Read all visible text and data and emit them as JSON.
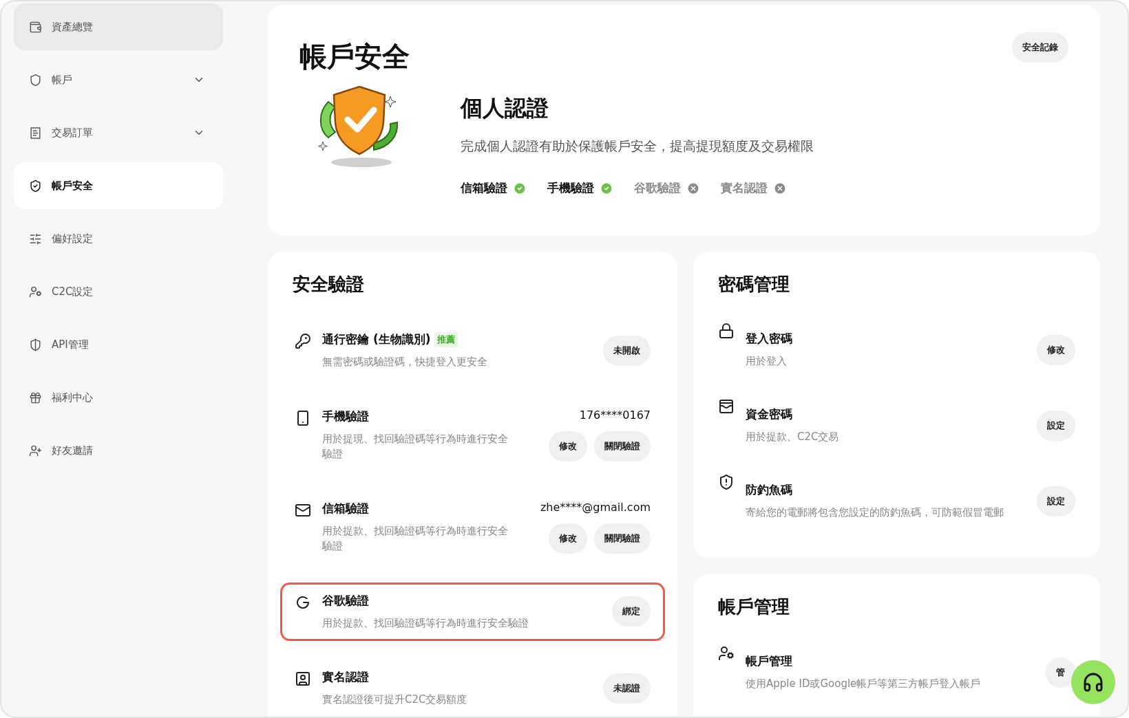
{
  "sidebar": {
    "items": [
      {
        "label": "資產總覽",
        "selected": false,
        "hovered": true,
        "expandable": false
      },
      {
        "label": "帳戶",
        "selected": false,
        "hovered": false,
        "expandable": true
      },
      {
        "label": "交易訂單",
        "selected": false,
        "hovered": false,
        "expandable": true
      },
      {
        "label": "帳戶安全",
        "selected": true,
        "hovered": false,
        "expandable": false
      },
      {
        "label": "偏好設定",
        "selected": false,
        "hovered": false,
        "expandable": false
      },
      {
        "label": "C2C設定",
        "selected": false,
        "hovered": false,
        "expandable": false
      },
      {
        "label": "API管理",
        "selected": false,
        "hovered": false,
        "expandable": false
      },
      {
        "label": "福利中心",
        "selected": false,
        "hovered": false,
        "expandable": false
      },
      {
        "label": "好友邀請",
        "selected": false,
        "hovered": false,
        "expandable": false
      }
    ]
  },
  "page_title": "帳戶安全",
  "history_button": "安全記錄",
  "identity": {
    "title": "個人認證",
    "description": "完成個人認證有助於保護帳戶安全，提高提現額度及交易權限",
    "statuses": [
      {
        "label": "信箱驗證",
        "verified": true
      },
      {
        "label": "手機驗證",
        "verified": true
      },
      {
        "label": "谷歌驗證",
        "verified": false
      },
      {
        "label": "實名認證",
        "verified": false
      }
    ]
  },
  "security": {
    "title": "安全驗證",
    "rows": [
      {
        "title": "通行密鑰 (生物識別)",
        "badge": "推薦",
        "description": "無需密碼或驗證碼，快捷登入更安全",
        "highlighted": false,
        "buttons": [
          "未開啟"
        ]
      },
      {
        "title": "手機驗證",
        "value": "176****0167",
        "description": "用於提現、找回驗證碼等行為時進行安全驗證",
        "highlighted": false,
        "buttons": [
          "修改",
          "關閉驗證"
        ]
      },
      {
        "title": "信箱驗證",
        "value": "zhe****@gmail.com",
        "description": "用於提款、找回驗證碼等行為時進行安全驗證",
        "highlighted": false,
        "buttons": [
          "修改",
          "關閉驗證"
        ]
      },
      {
        "title": "谷歌驗證",
        "description": "用於提款、找回驗證碼等行為時進行安全驗證",
        "highlighted": true,
        "buttons": [
          "綁定"
        ]
      },
      {
        "title": "實名認證",
        "description": "實名認證後可提升C2C交易額度",
        "highlighted": false,
        "buttons": [
          "未認證"
        ]
      }
    ]
  },
  "passwords": {
    "title": "密碼管理",
    "rows": [
      {
        "title": "登入密碼",
        "description": "用於登入",
        "buttons": [
          "修改"
        ]
      },
      {
        "title": "資金密碼",
        "description": "用於提款、C2C交易",
        "buttons": [
          "設定"
        ]
      },
      {
        "title": "防釣魚碼",
        "description": "寄給您的電郵將包含您設定的防釣魚碼，可防範假冒電郵",
        "buttons": [
          "設定"
        ]
      }
    ]
  },
  "account": {
    "title": "帳戶管理",
    "rows": [
      {
        "title": "帳戶管理",
        "description": "使用Apple ID或Google帳戶等第三方帳戶登入帳戶",
        "buttons": [
          "管"
        ]
      }
    ]
  }
}
